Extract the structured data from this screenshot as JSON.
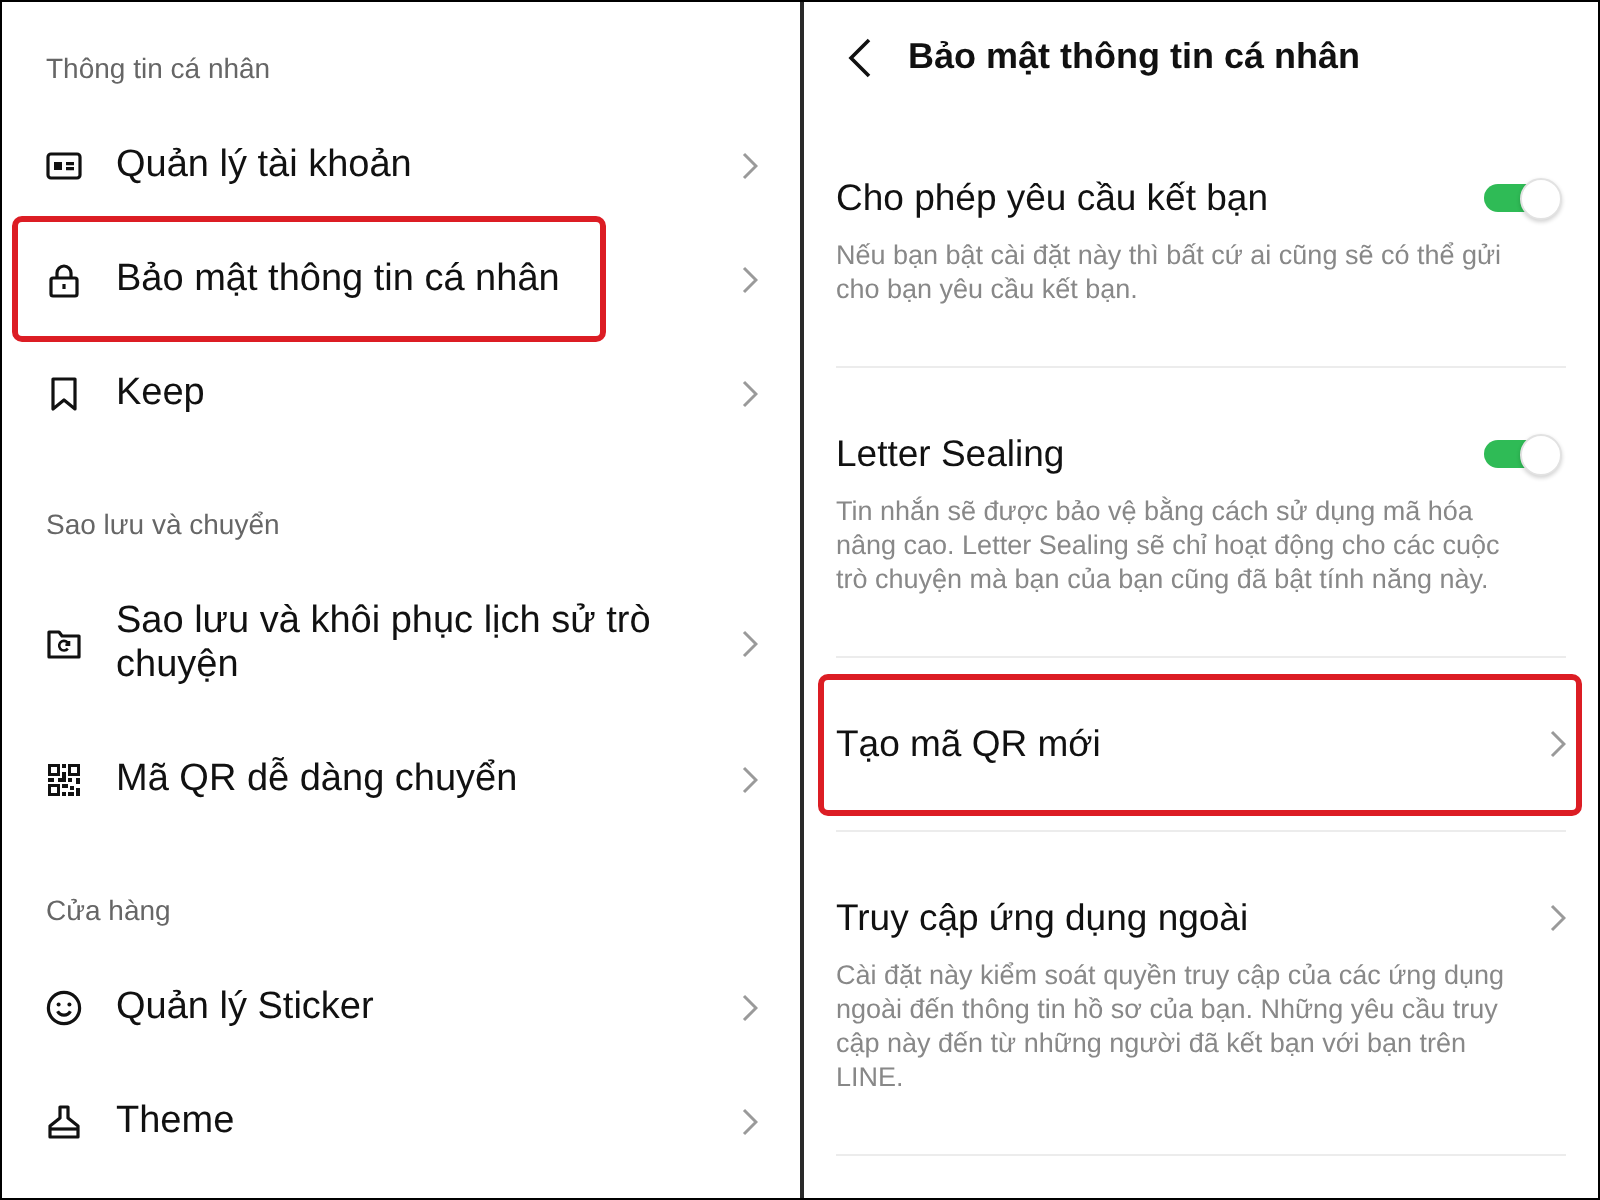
{
  "left_panel": {
    "sections": [
      {
        "header": "Thông tin cá nhân",
        "items": [
          {
            "label": "Quản lý tài khoản",
            "highlighted": false
          },
          {
            "label": "Bảo mật thông tin cá nhân",
            "highlighted": true
          },
          {
            "label": "Keep",
            "highlighted": false
          }
        ]
      },
      {
        "header": "Sao lưu và chuyển",
        "items": [
          {
            "label": "Sao lưu và khôi phục lịch sử trò chuyện",
            "highlighted": false
          },
          {
            "label": "Mã QR dễ dàng chuyển",
            "highlighted": false
          }
        ]
      },
      {
        "header": "Cửa hàng",
        "items": [
          {
            "label": "Quản lý Sticker",
            "highlighted": false
          },
          {
            "label": "Theme",
            "highlighted": false
          }
        ]
      }
    ]
  },
  "right_panel": {
    "title": "Bảo mật thông tin cá nhân",
    "settings": [
      {
        "kind": "toggle",
        "title": "Cho phép yêu cầu kết bạn",
        "description": "Nếu bạn bật cài đặt này thì bất cứ ai cũng sẽ có thể gửi cho bạn yêu cầu kết bạn.",
        "on": true,
        "highlighted": false
      },
      {
        "kind": "toggle",
        "title": "Letter Sealing",
        "description": "Tin nhắn sẽ được bảo vệ bằng cách sử dụng mã hóa nâng cao. Letter Sealing sẽ chỉ hoạt động cho các cuộc trò chuyện mà bạn của bạn cũng đã bật tính năng này.",
        "on": true,
        "highlighted": false
      },
      {
        "kind": "link",
        "title": "Tạo mã QR mới",
        "highlighted": true
      },
      {
        "kind": "link",
        "title": "Truy cập ứng dụng ngoài",
        "description": "Cài đặt này kiểm soát quyền truy cập của các ứng dụng ngoài đến thông tin hồ sơ của bạn. Những yêu cầu truy cập này đến từ những người đã kết bạn với bạn trên LINE.",
        "highlighted": false
      }
    ]
  }
}
